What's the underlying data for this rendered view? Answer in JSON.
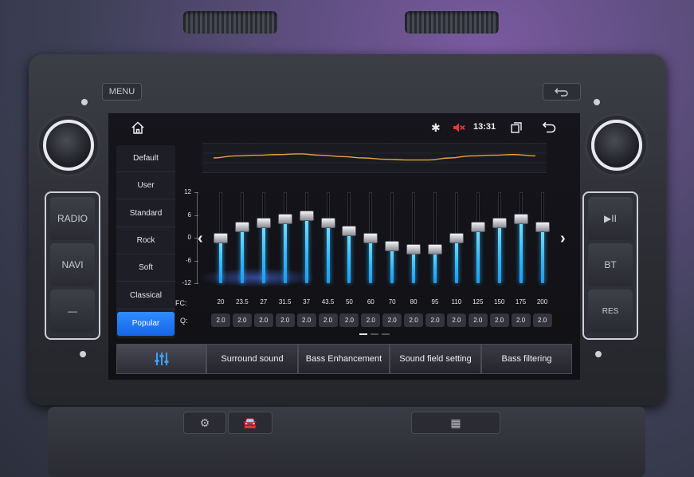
{
  "device": {
    "menu_label": "MENU",
    "left_buttons": [
      "RADIO",
      "NAVI",
      "—"
    ],
    "right_buttons": [
      "▶II",
      "BT",
      "RES"
    ]
  },
  "status": {
    "time": "13:31",
    "icons": [
      "home-icon",
      "bluetooth-icon",
      "mute-icon",
      "windows-icon",
      "return-icon"
    ]
  },
  "presets": [
    {
      "label": "Default",
      "active": false
    },
    {
      "label": "User",
      "active": false
    },
    {
      "label": "Standard",
      "active": false
    },
    {
      "label": "Rock",
      "active": false
    },
    {
      "label": "Soft",
      "active": false
    },
    {
      "label": "Classical",
      "active": false
    },
    {
      "label": "Popular",
      "active": true
    }
  ],
  "eq": {
    "scale": [
      "12",
      "6",
      "0",
      "-6",
      "-12"
    ],
    "range": [
      -12,
      12
    ],
    "fc_label": "FC:",
    "q_label": "Q:",
    "bands": [
      {
        "fc": "20",
        "q": "2.0",
        "gain": 0
      },
      {
        "fc": "23.5",
        "q": "2.0",
        "gain": 3
      },
      {
        "fc": "27",
        "q": "2.0",
        "gain": 4
      },
      {
        "fc": "31.5",
        "q": "2.0",
        "gain": 5
      },
      {
        "fc": "37",
        "q": "2.0",
        "gain": 6
      },
      {
        "fc": "43.5",
        "q": "2.0",
        "gain": 4
      },
      {
        "fc": "50",
        "q": "2.0",
        "gain": 2
      },
      {
        "fc": "60",
        "q": "2.0",
        "gain": 0
      },
      {
        "fc": "70",
        "q": "2.0",
        "gain": -2
      },
      {
        "fc": "80",
        "q": "2.0",
        "gain": -3
      },
      {
        "fc": "95",
        "q": "2.0",
        "gain": -3
      },
      {
        "fc": "110",
        "q": "2.0",
        "gain": 0
      },
      {
        "fc": "125",
        "q": "2.0",
        "gain": 3
      },
      {
        "fc": "150",
        "q": "2.0",
        "gain": 4
      },
      {
        "fc": "175",
        "q": "2.0",
        "gain": 5
      },
      {
        "fc": "200",
        "q": "2.0",
        "gain": 3
      }
    ],
    "prev_label": "‹",
    "next_label": "›"
  },
  "tabs": [
    "",
    "Surround sound",
    "Bass Enhancement",
    "Sound field setting",
    "Bass filtering"
  ],
  "colors": {
    "accent": "#1f7cf0",
    "slider_fill": "#2fb7ff",
    "curve": "#e8a23a"
  }
}
